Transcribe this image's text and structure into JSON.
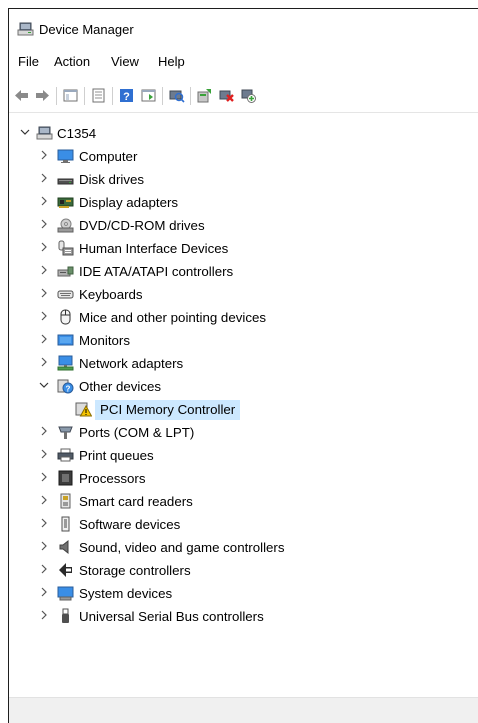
{
  "window": {
    "title": "Device Manager",
    "icon": "device-manager-icon"
  },
  "menu": [
    {
      "label": "File"
    },
    {
      "label": "Action"
    },
    {
      "label": "View"
    },
    {
      "label": "Help"
    }
  ],
  "toolbar": [
    {
      "icon": "back-arrow-icon"
    },
    {
      "icon": "forward-arrow-icon"
    },
    {
      "icon": "show-hide-console-tree-icon"
    },
    {
      "icon": "properties-icon"
    },
    {
      "icon": "help-icon"
    },
    {
      "icon": "action-pane-icon"
    },
    {
      "icon": "scan-hardware-changes-icon"
    },
    {
      "icon": "update-driver-icon"
    },
    {
      "icon": "uninstall-device-icon"
    },
    {
      "icon": "add-legacy-hardware-icon"
    }
  ],
  "tree": {
    "root": {
      "label": "C1354",
      "icon": "computer-tree-root-icon",
      "expanded": true
    },
    "categories": [
      {
        "label": "Computer",
        "icon": "computer-icon",
        "expanded": false
      },
      {
        "label": "Disk drives",
        "icon": "disk-drive-icon",
        "expanded": false
      },
      {
        "label": "Display adapters",
        "icon": "display-adapter-icon",
        "expanded": false
      },
      {
        "label": "DVD/CD-ROM drives",
        "icon": "dvd-drive-icon",
        "expanded": false
      },
      {
        "label": "Human Interface Devices",
        "icon": "hid-icon",
        "expanded": false
      },
      {
        "label": "IDE ATA/ATAPI controllers",
        "icon": "ide-controller-icon",
        "expanded": false
      },
      {
        "label": "Keyboards",
        "icon": "keyboard-icon",
        "expanded": false
      },
      {
        "label": "Mice and other pointing devices",
        "icon": "mouse-icon",
        "expanded": false
      },
      {
        "label": "Monitors",
        "icon": "monitor-icon",
        "expanded": false
      },
      {
        "label": "Network adapters",
        "icon": "network-adapter-icon",
        "expanded": false
      },
      {
        "label": "Other devices",
        "icon": "other-devices-icon",
        "expanded": true,
        "children": [
          {
            "label": "PCI Memory Controller",
            "icon": "warning-device-icon",
            "selected": true
          }
        ]
      },
      {
        "label": "Ports (COM & LPT)",
        "icon": "port-icon",
        "expanded": false
      },
      {
        "label": "Print queues",
        "icon": "printer-icon",
        "expanded": false
      },
      {
        "label": "Processors",
        "icon": "processor-icon",
        "expanded": false
      },
      {
        "label": "Smart card readers",
        "icon": "smart-card-icon",
        "expanded": false
      },
      {
        "label": "Software devices",
        "icon": "software-device-icon",
        "expanded": false
      },
      {
        "label": "Sound, video and game controllers",
        "icon": "speaker-icon",
        "expanded": false
      },
      {
        "label": "Storage controllers",
        "icon": "storage-controller-icon",
        "expanded": false
      },
      {
        "label": "System devices",
        "icon": "system-device-icon",
        "expanded": false
      },
      {
        "label": "Universal Serial Bus controllers",
        "icon": "usb-icon",
        "expanded": false
      }
    ]
  },
  "colors": {
    "selection": "#cce8ff",
    "monitor_blue": "#3a8ee6",
    "warning_yellow": "#f5c400"
  }
}
